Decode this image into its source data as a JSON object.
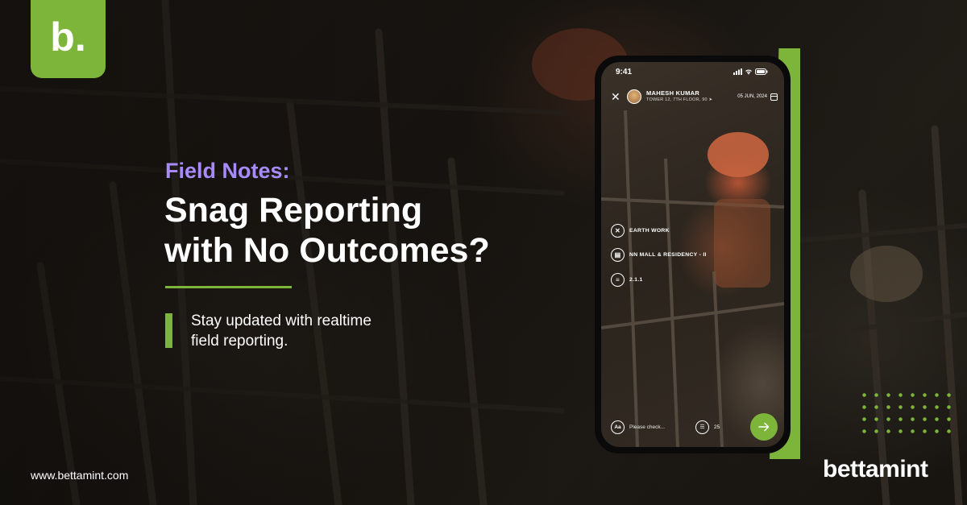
{
  "brand": {
    "badge_letter": "b.",
    "wordmark": "bettamint",
    "website": "www.bettamint.com",
    "accent_color": "#7db53b",
    "eyebrow_color": "#a78bfa"
  },
  "hero": {
    "eyebrow": "Field Notes:",
    "headline_line1": "Snag Reporting",
    "headline_line2": "with No Outcomes?",
    "subtext_line1": "Stay updated with realtime",
    "subtext_line2": "field reporting."
  },
  "phone": {
    "status_time": "9:41",
    "status_icons": [
      "signal-icon",
      "wifi-icon",
      "battery-icon"
    ],
    "header": {
      "user_name": "MAHESH KUMAR",
      "user_location": "TOWER 12, 7TH FLOOR, 90",
      "date": "05 JUN, 2024"
    },
    "tags": [
      {
        "icon": "tools-icon",
        "label": "EARTH WORK"
      },
      {
        "icon": "building-icon",
        "label": "NN MALL & RESIDENCY - II"
      },
      {
        "icon": "code-icon",
        "label": "2.1.1"
      }
    ],
    "composer": {
      "font_button": "Aa",
      "placeholder": "Please check...",
      "count": "25"
    }
  }
}
